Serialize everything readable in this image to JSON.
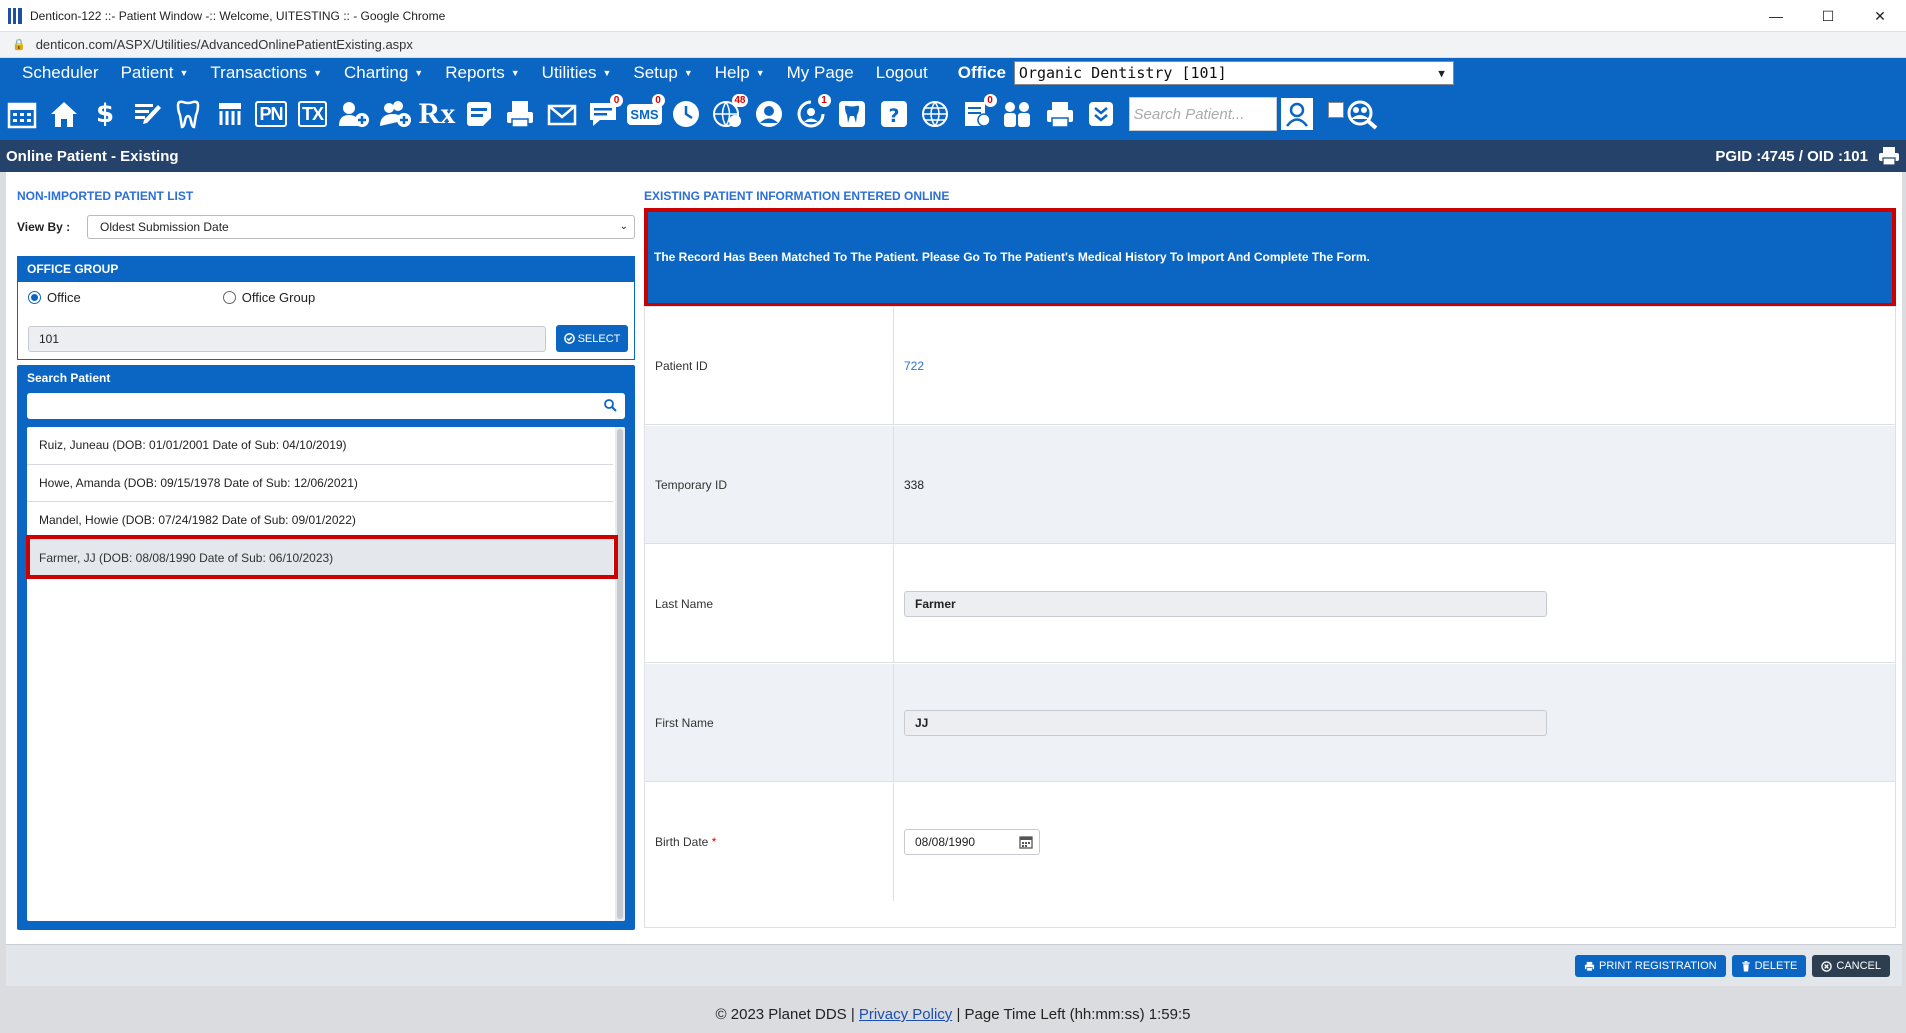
{
  "browser": {
    "window_title": "Denticon-122 ::- Patient Window -:: Welcome, UITESTING :: - Google Chrome",
    "url": "denticon.com/ASPX/Utilities/AdvancedOnlinePatientExisting.aspx"
  },
  "menu": {
    "items": [
      "Scheduler",
      "Patient",
      "Transactions",
      "Charting",
      "Reports",
      "Utilities",
      "Setup",
      "Help",
      "My Page",
      "Logout"
    ],
    "has_caret": [
      false,
      true,
      true,
      true,
      true,
      true,
      true,
      true,
      false,
      false
    ],
    "office_label": "Office",
    "office_value": "Organic Dentistry [101]"
  },
  "toolbar": {
    "text_icons": {
      "pn": "PN",
      "tx": "TX",
      "rx": "Rx",
      "sms": "SMS"
    },
    "badges": {
      "notes": "0",
      "sms": "0",
      "globe": "48",
      "support": "1",
      "reports": "0"
    },
    "search_placeholder": "Search Patient..."
  },
  "page_header": {
    "title": "Online Patient - Existing",
    "ids": "PGID :4745  /  OID :101"
  },
  "left_panel": {
    "section_title": "NON-IMPORTED PATIENT LIST",
    "view_by_label": "View By :",
    "view_by_value": "Oldest Submission Date",
    "office_group": {
      "title": "OFFICE GROUP",
      "radio_office": "Office",
      "radio_office_group": "Office Group",
      "selected": "Office",
      "office_value": "101",
      "select_button": "SELECT"
    },
    "search": {
      "title": "Search Patient",
      "value": ""
    },
    "patients": [
      "Ruiz, Juneau (DOB: 01/01/2001 Date of Sub: 04/10/2019)",
      "Howe, Amanda (DOB: 09/15/1978 Date of Sub: 12/06/2021)",
      "Mandel, Howie (DOB: 07/24/1982 Date of Sub: 09/01/2022)",
      "Farmer, JJ (DOB: 08/08/1990 Date of Sub: 06/10/2023)"
    ],
    "selected_index": 3
  },
  "right_panel": {
    "section_title": "EXISTING PATIENT INFORMATION ENTERED ONLINE",
    "banner": "The Record Has Been Matched To The Patient. Please Go To The Patient's Medical History To Import And Complete The Form.",
    "fields": {
      "patient_id_label": "Patient ID",
      "patient_id": "722",
      "temporary_id_label": "Temporary ID",
      "temporary_id": "338",
      "last_name_label": "Last Name",
      "last_name": "Farmer",
      "first_name_label": "First Name",
      "first_name": "JJ",
      "birth_date_label": "Birth Date",
      "birth_date_required": "*",
      "birth_date": "08/08/1990"
    }
  },
  "actions": {
    "print": "PRINT REGISTRATION",
    "delete": "DELETE",
    "cancel": "CANCEL"
  },
  "footer": {
    "copyright": "© 2023 Planet DDS |",
    "privacy": "Privacy Policy",
    "time_left": "| Page Time Left (hh:mm:ss) 1:59:5"
  },
  "colors": {
    "brand_blue": "#0b66c3",
    "header_navy": "#25426a",
    "highlight_red": "#cc0000",
    "link_blue": "#2b6fd8"
  }
}
